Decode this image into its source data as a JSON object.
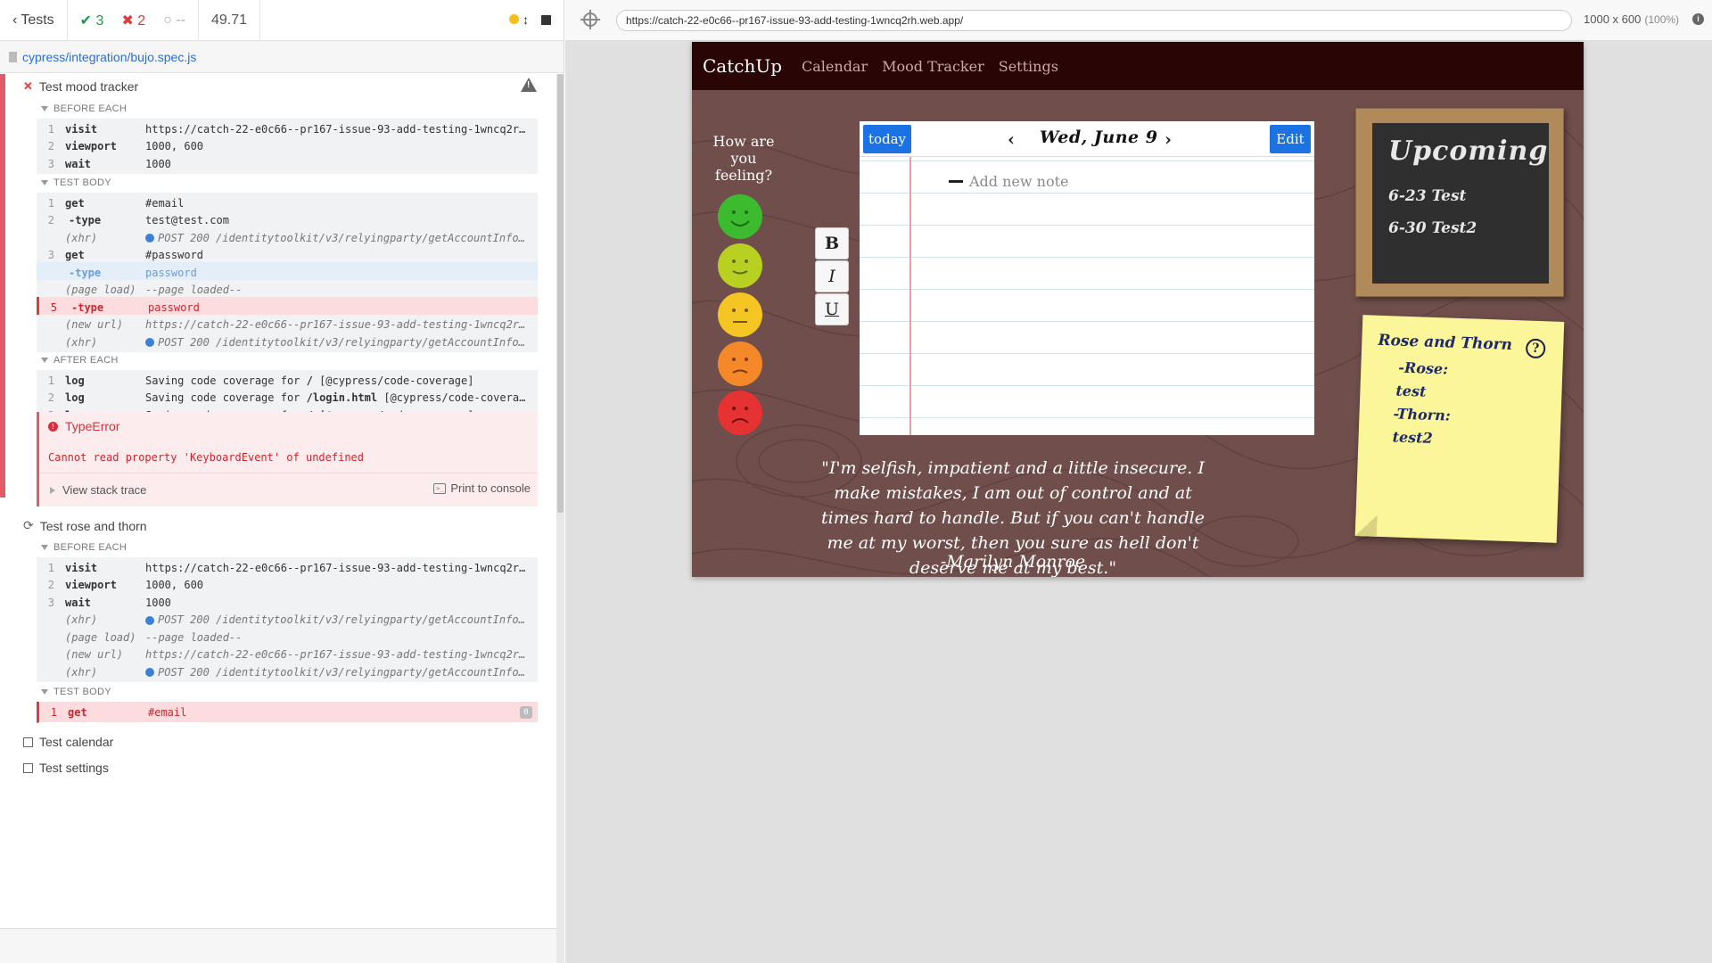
{
  "reporter": {
    "header": {
      "tests_label": "Tests",
      "passed": "3",
      "failed": "2",
      "pending": "--",
      "duration": "49.71"
    },
    "spec_file": "cypress/integration/bujo.spec.js",
    "mood_test": {
      "title": "Test mood tracker",
      "before_each_label": "BEFORE EACH",
      "before_each": [
        {
          "num": "1",
          "name": "visit",
          "msg": "https://catch-22-e0c66--pr167-issue-93-add-testing-1wncq2rh.web.app/"
        },
        {
          "num": "2",
          "name": "viewport",
          "msg": "1000, 600"
        },
        {
          "num": "3",
          "name": "wait",
          "msg": "1000"
        }
      ],
      "test_body_label": "TEST BODY",
      "test_body": [
        {
          "num": "1",
          "name": "get",
          "msg": "#email"
        },
        {
          "num": "2",
          "name": "-type",
          "msg": "test@test.com"
        },
        {
          "num": "",
          "name": "(xhr)",
          "msg": "POST 200 /identitytoolkit/v3/relyingparty/getAccountInfo?key=..."
        },
        {
          "num": "3",
          "name": "get",
          "msg": "#password"
        },
        {
          "num": "",
          "name": "-type",
          "msg": "password"
        },
        {
          "num": "",
          "name": "(page load)",
          "msg": "--page loaded--"
        },
        {
          "num": "5",
          "name": "-type",
          "msg": "password"
        },
        {
          "num": "",
          "name": "(new url)",
          "msg": "https://catch-22-e0c66--pr167-issue-93-add-testing-1wncq2rh.web.app/"
        },
        {
          "num": "",
          "name": "(xhr)",
          "msg": "POST 200 /identitytoolkit/v3/relyingparty/getAccountInfo?key=..."
        }
      ],
      "after_each_label": "AFTER EACH",
      "after_each": [
        {
          "num": "1",
          "name": "log",
          "msg_pre": "Saving code coverage for ",
          "msg_bold": "/",
          "msg_post": " [@cypress/code-coverage]"
        },
        {
          "num": "2",
          "name": "log",
          "msg_pre": "Saving code coverage for ",
          "msg_bold": "/login.html",
          "msg_post": " [@cypress/code-coverage]"
        },
        {
          "num": "3",
          "name": "log",
          "msg_pre": "Saving code coverage for ",
          "msg_bold": "/",
          "msg_post": " [@cypress/code-coverage]"
        }
      ],
      "error": {
        "type": "TypeError",
        "message": "Cannot read property 'KeyboardEvent' of undefined",
        "stack_label": "View stack trace",
        "print_label": "Print to console"
      }
    },
    "rose_test": {
      "title": "Test rose and thorn",
      "before_each_label": "BEFORE EACH",
      "before_each": [
        {
          "num": "1",
          "name": "visit",
          "msg": "https://catch-22-e0c66--pr167-issue-93-add-testing-1wncq2rh.web.app/"
        },
        {
          "num": "2",
          "name": "viewport",
          "msg": "1000, 600"
        },
        {
          "num": "3",
          "name": "wait",
          "msg": "1000"
        },
        {
          "num": "",
          "name": "(xhr)",
          "msg": "POST 200 /identitytoolkit/v3/relyingparty/getAccountInfo?key=..."
        },
        {
          "num": "",
          "name": "(page load)",
          "msg": "--page loaded--"
        },
        {
          "num": "",
          "name": "(new url)",
          "msg": "https://catch-22-e0c66--pr167-issue-93-add-testing-1wncq2rh.web.app/"
        },
        {
          "num": "",
          "name": "(xhr)",
          "msg": "POST 200 /identitytoolkit/v3/relyingparty/getAccountInfo?key=..."
        }
      ],
      "test_body_label": "TEST BODY",
      "test_body": [
        {
          "num": "1",
          "name": "get",
          "msg": "#email",
          "badge": "0"
        }
      ]
    },
    "other_tests": [
      "Test calendar",
      "Test settings"
    ]
  },
  "aut": {
    "url": "https://catch-22-e0c66--pr167-issue-93-add-testing-1wncq2rh.web.app/",
    "viewport": "1000 x 600",
    "zoom": "(100%)",
    "app": {
      "brand": "CatchUp",
      "nav": [
        "Calendar",
        "Mood Tracker",
        "Settings"
      ],
      "mood_title": "How are you feeling?",
      "format_buttons": [
        "B",
        "I",
        "U"
      ],
      "today_label": "today",
      "edit_label": "Edit",
      "date": "Wed, June 9",
      "note_placeholder": "Add new note",
      "quote": "\"I'm selfish, impatient and a little insecure. I make mistakes, I am out of control and at times hard to handle. But if you can't handle me at my worst, then you sure as hell don't deserve me at my best.\"",
      "quote_author": "-Marilyn Monroe",
      "upcoming_title": "Upcoming",
      "upcoming": [
        "6-23 Test",
        "6-30 Test2"
      ],
      "rose_thorn_title": "Rose and Thorn",
      "rose_label": "-Rose:",
      "rose_value": "test",
      "thorn_label": "-Thorn:",
      "thorn_value": "test2"
    }
  },
  "colors": {
    "pass": "#1e9a4a",
    "fail": "#e03a3a",
    "nav_bg": "#2a0506",
    "button_blue": "#1d72e3",
    "mood_colors": [
      "#3dbb2f",
      "#b7d022",
      "#f5c524",
      "#f5892a",
      "#e63232"
    ]
  }
}
